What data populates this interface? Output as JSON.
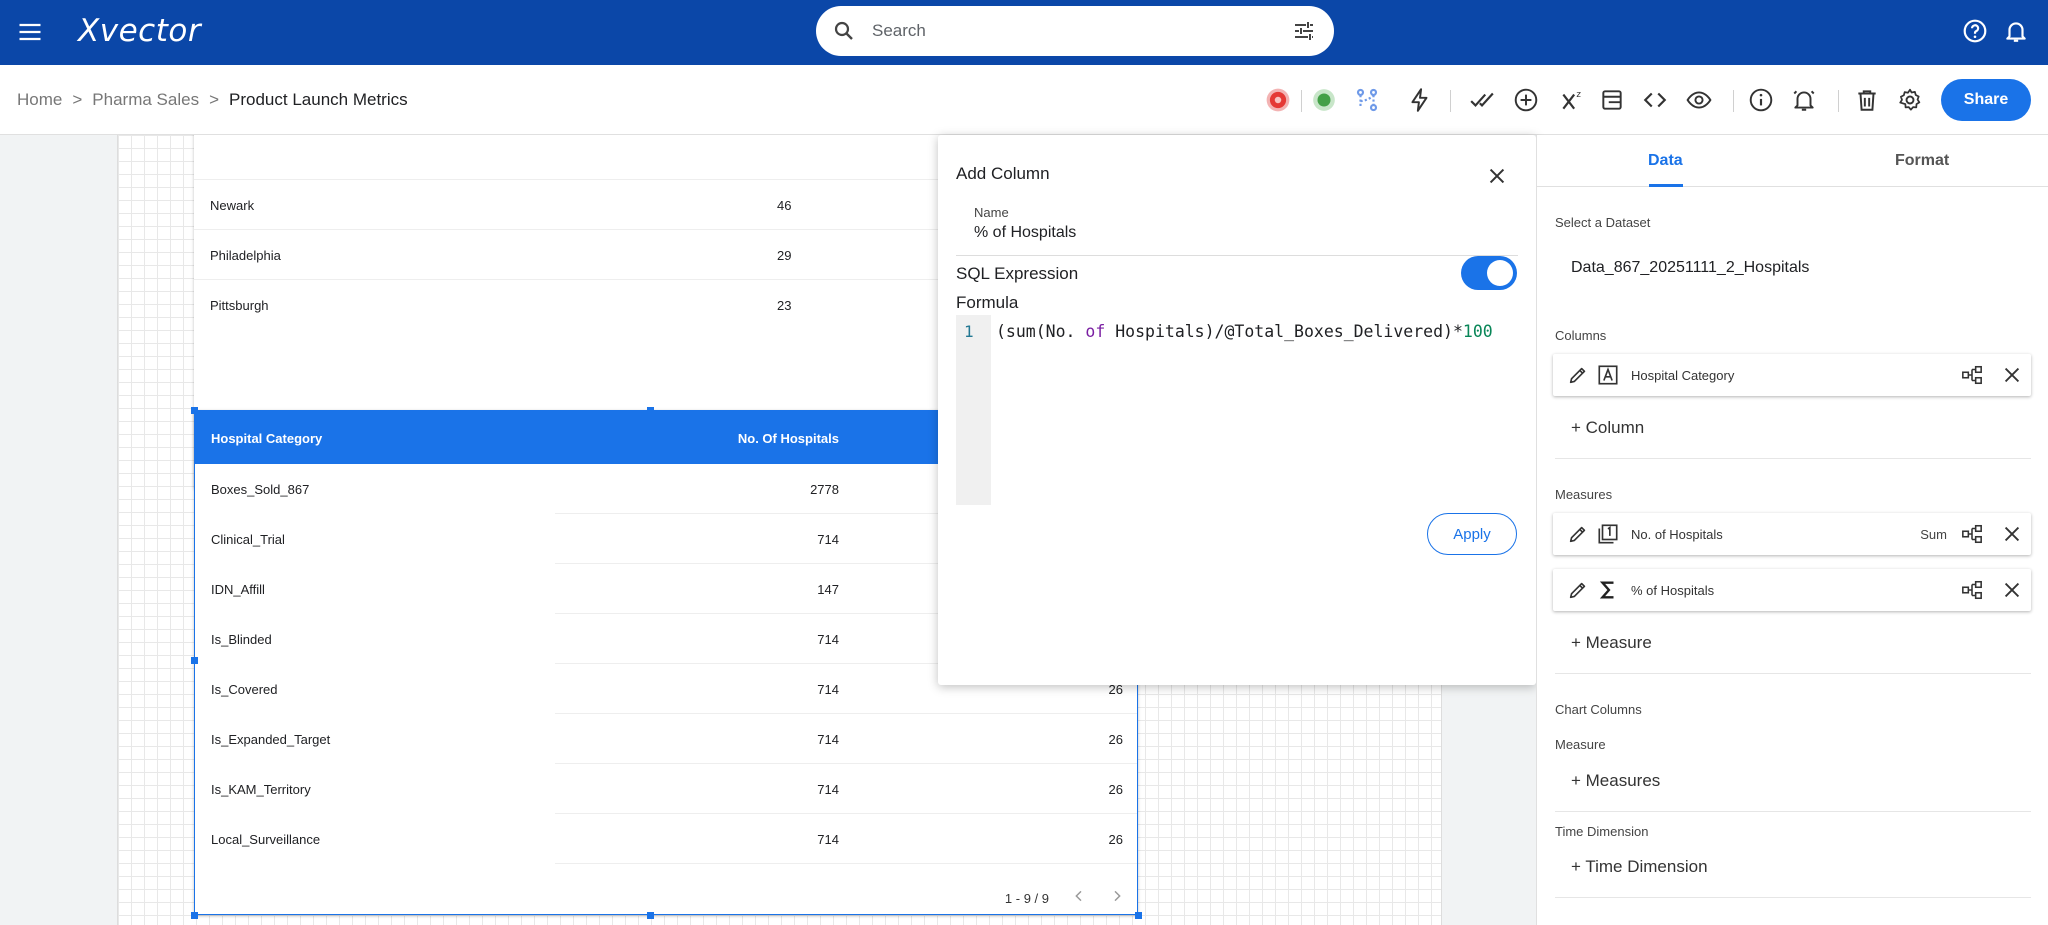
{
  "app": {
    "brand": "Xvector",
    "search_placeholder": "Search"
  },
  "breadcrumb": {
    "items": [
      "Home",
      "Pharma Sales",
      "Product Launch Metrics"
    ],
    "separator": ">"
  },
  "toolbar": {
    "share_label": "Share"
  },
  "table_top": {
    "rows": [
      {
        "name": "Newark",
        "value": "46"
      },
      {
        "name": "Philadelphia",
        "value": "29"
      },
      {
        "name": "Pittsburgh",
        "value": "23"
      }
    ]
  },
  "table_main": {
    "headers": [
      "Hospital Category",
      "No. Of Hospitals"
    ],
    "rows": [
      {
        "name": "Boxes_Sold_867",
        "value": "2778",
        "extra": ""
      },
      {
        "name": "Clinical_Trial",
        "value": "714",
        "extra": ""
      },
      {
        "name": "IDN_Affill",
        "value": "147",
        "extra": ""
      },
      {
        "name": "Is_Blinded",
        "value": "714",
        "extra": ""
      },
      {
        "name": "Is_Covered",
        "value": "714",
        "extra": "26"
      },
      {
        "name": "Is_Expanded_Target",
        "value": "714",
        "extra": "26"
      },
      {
        "name": "Is_KAM_Territory",
        "value": "714",
        "extra": "26"
      },
      {
        "name": "Local_Surveillance",
        "value": "714",
        "extra": "26"
      }
    ],
    "pager": "1 - 9 / 9"
  },
  "add_column": {
    "title": "Add Column",
    "name_label": "Name",
    "name_value": "% of Hospitals",
    "sql_label": "SQL Expression",
    "sql_enabled": true,
    "formula_label": "Formula",
    "line_number": "1",
    "code_pre": "(sum(No. ",
    "code_kw": "of",
    "code_mid": " Hospitals)/@Total_Boxes_Delivered)*",
    "code_num": "100",
    "apply_label": "Apply"
  },
  "panel": {
    "tabs": [
      "Data",
      "Format"
    ],
    "active_tab": "Data",
    "dataset_label": "Select a Dataset",
    "dataset_value": "Data_867_20251111_2_Hospitals",
    "columns_label": "Columns",
    "columns": [
      {
        "name": "Hospital Category",
        "type_icon": "text-type-icon"
      }
    ],
    "add_column_label": "+ Column",
    "measures_label": "Measures",
    "measures": [
      {
        "name": "No. of Hospitals",
        "agg": "Sum",
        "type_icon": "count-type-icon"
      },
      {
        "name": "% of Hospitals",
        "agg": "",
        "type_icon": "sigma-icon"
      }
    ],
    "add_measure_label": "+ Measure",
    "chart_columns_label": "Chart Columns",
    "measure_label": "Measure",
    "add_measures_label": "+ Measures",
    "time_dimension_label": "Time Dimension",
    "add_time_dimension_label": "+ Time Dimension"
  },
  "colors": {
    "topbar": "#0b47a8",
    "accent": "#1a73e8"
  }
}
